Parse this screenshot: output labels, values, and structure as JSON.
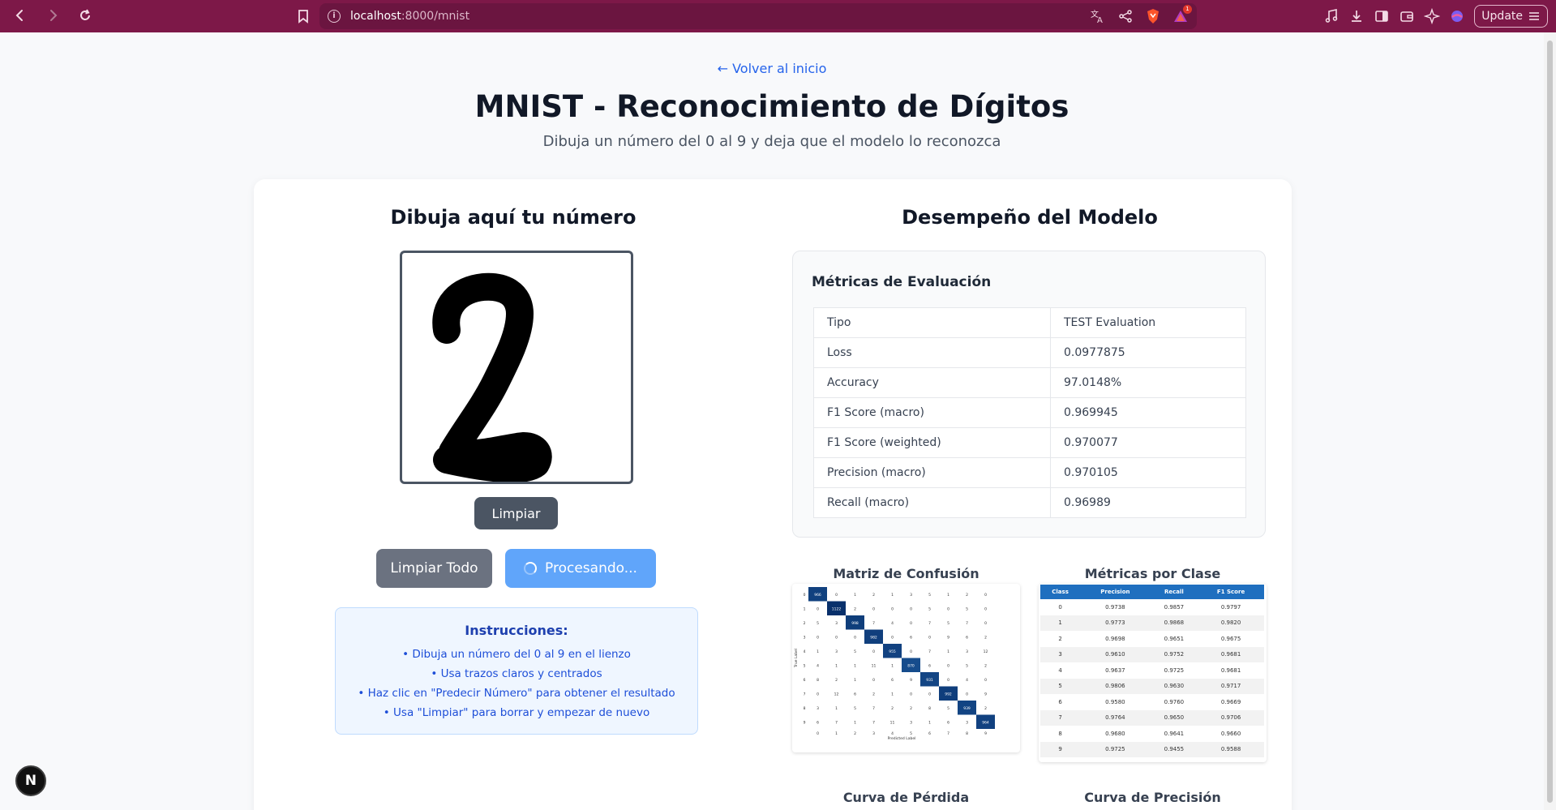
{
  "browser": {
    "url_host": "localhost",
    "url_path": ":8000/mnist",
    "update_label": "Update",
    "notification_count": "1"
  },
  "page": {
    "back_link": "← Volver al inicio",
    "title": "MNIST - Reconocimiento de Dígitos",
    "subtitle": "Dibuja un número del 0 al 9 y deja que el modelo lo reconozca"
  },
  "drawing": {
    "title": "Dibuja aquí tu número",
    "clear_label": "Limpiar",
    "clear_all_label": "Limpiar Todo",
    "process_label": "Procesando...",
    "instructions_title": "Instrucciones:",
    "instructions": [
      "• Dibuja un número del 0 al 9 en el lienzo",
      "• Usa trazos claros y centrados",
      "• Haz clic en \"Predecir Número\" para obtener el resultado",
      "• Usa \"Limpiar\" para borrar y empezar de nuevo"
    ]
  },
  "performance": {
    "title": "Desempeño del Modelo",
    "metrics_title": "Métricas de Evaluación",
    "metrics": [
      {
        "key": "Tipo",
        "value": "TEST Evaluation"
      },
      {
        "key": "Loss",
        "value": "0.0977875"
      },
      {
        "key": "Accuracy",
        "value": "97.0148%"
      },
      {
        "key": "F1 Score (macro)",
        "value": "0.969945"
      },
      {
        "key": "F1 Score (weighted)",
        "value": "0.970077"
      },
      {
        "key": "Precision (macro)",
        "value": "0.970105"
      },
      {
        "key": "Recall (macro)",
        "value": "0.96989"
      }
    ],
    "confusion_title": "Matriz de Confusión",
    "class_metrics_title": "Métricas por Clase",
    "loss_curve_title": "Curva de Pérdida",
    "acc_curve_title": "Curva de Precisión"
  },
  "confusion_matrix": {
    "xlabel": "Predicted Label",
    "ylabel": "True Label",
    "labels": [
      "0",
      "1",
      "2",
      "3",
      "4",
      "5",
      "6",
      "7",
      "8",
      "9"
    ],
    "rows": [
      [
        966,
        0,
        1,
        2,
        1,
        3,
        5,
        1,
        2,
        0
      ],
      [
        0,
        1122,
        2,
        0,
        0,
        0,
        5,
        0,
        5,
        0
      ],
      [
        5,
        3,
        998,
        7,
        4,
        0,
        7,
        5,
        7,
        0
      ],
      [
        0,
        0,
        0,
        982,
        0,
        6,
        0,
        9,
        6,
        2
      ],
      [
        1,
        3,
        5,
        0,
        955,
        0,
        7,
        1,
        3,
        12
      ],
      [
        4,
        1,
        1,
        11,
        1,
        870,
        6,
        0,
        5,
        2
      ],
      [
        8,
        2,
        1,
        0,
        6,
        9,
        931,
        0,
        4,
        0
      ],
      [
        0,
        12,
        6,
        2,
        1,
        0,
        0,
        992,
        0,
        9
      ],
      [
        3,
        1,
        5,
        7,
        2,
        2,
        8,
        5,
        939,
        2
      ],
      [
        6,
        7,
        1,
        7,
        11,
        3,
        1,
        6,
        3,
        964
      ]
    ]
  },
  "class_metrics": {
    "headers": [
      "Class",
      "Precision",
      "Recall",
      "F1 Score"
    ],
    "rows": [
      [
        "0",
        "0.9738",
        "0.9857",
        "0.9797"
      ],
      [
        "1",
        "0.9773",
        "0.9868",
        "0.9820"
      ],
      [
        "2",
        "0.9698",
        "0.9651",
        "0.9675"
      ],
      [
        "3",
        "0.9610",
        "0.9752",
        "0.9681"
      ],
      [
        "4",
        "0.9637",
        "0.9725",
        "0.9681"
      ],
      [
        "5",
        "0.9806",
        "0.9630",
        "0.9717"
      ],
      [
        "6",
        "0.9580",
        "0.9760",
        "0.9669"
      ],
      [
        "7",
        "0.9764",
        "0.9650",
        "0.9706"
      ],
      [
        "8",
        "0.9680",
        "0.9641",
        "0.9660"
      ],
      [
        "9",
        "0.9725",
        "0.9455",
        "0.9588"
      ]
    ]
  },
  "colors": {
    "chrome": "#7d1848",
    "accent_blue": "#2563eb",
    "matrix_dark": "#08306b",
    "matrix_header": "#1f6fbf"
  },
  "icons": [
    "back-icon",
    "forward-icon",
    "reload-icon",
    "bookmark-icon",
    "info-icon",
    "translate-icon",
    "share-icon",
    "brave-shield-icon",
    "brave-rewards-icon",
    "music-icon",
    "download-icon",
    "sidebar-icon",
    "wallet-icon",
    "leo-icon",
    "vpn-icon",
    "menu-icon"
  ]
}
